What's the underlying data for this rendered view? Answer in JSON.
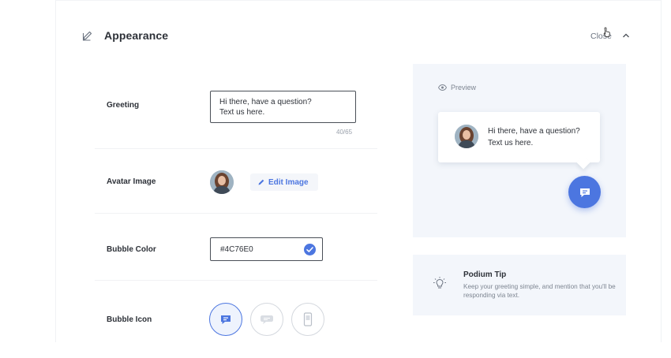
{
  "header": {
    "title": "Appearance",
    "close_label": "Close",
    "edit_icon": "pencil-icon",
    "chevron_icon": "chevron-up-icon"
  },
  "form": {
    "greeting": {
      "label": "Greeting",
      "value_line1": "Hi there, have a question?",
      "value_line2": "Text us here.",
      "char_count": "40/65"
    },
    "avatar": {
      "label": "Avatar Image",
      "edit_label": "Edit Image"
    },
    "bubble_color": {
      "label": "Bubble Color",
      "value": "#4C76E0"
    },
    "bubble_icon": {
      "label": "Bubble Icon",
      "options": [
        "chat-bubble-icon",
        "message-bubble-icon",
        "phone-icon"
      ],
      "selected": 0
    }
  },
  "preview": {
    "label": "Preview",
    "line1": "Hi there, have a question?",
    "line2": "Text us here."
  },
  "tip": {
    "title": "Podium Tip",
    "body": "Keep your greeting simple, and mention that you'll be responding via text."
  },
  "colors": {
    "accent": "#4C76E0",
    "panel_bg": "#F3F6FB",
    "text": "#2D3138",
    "muted": "#7D8591"
  }
}
